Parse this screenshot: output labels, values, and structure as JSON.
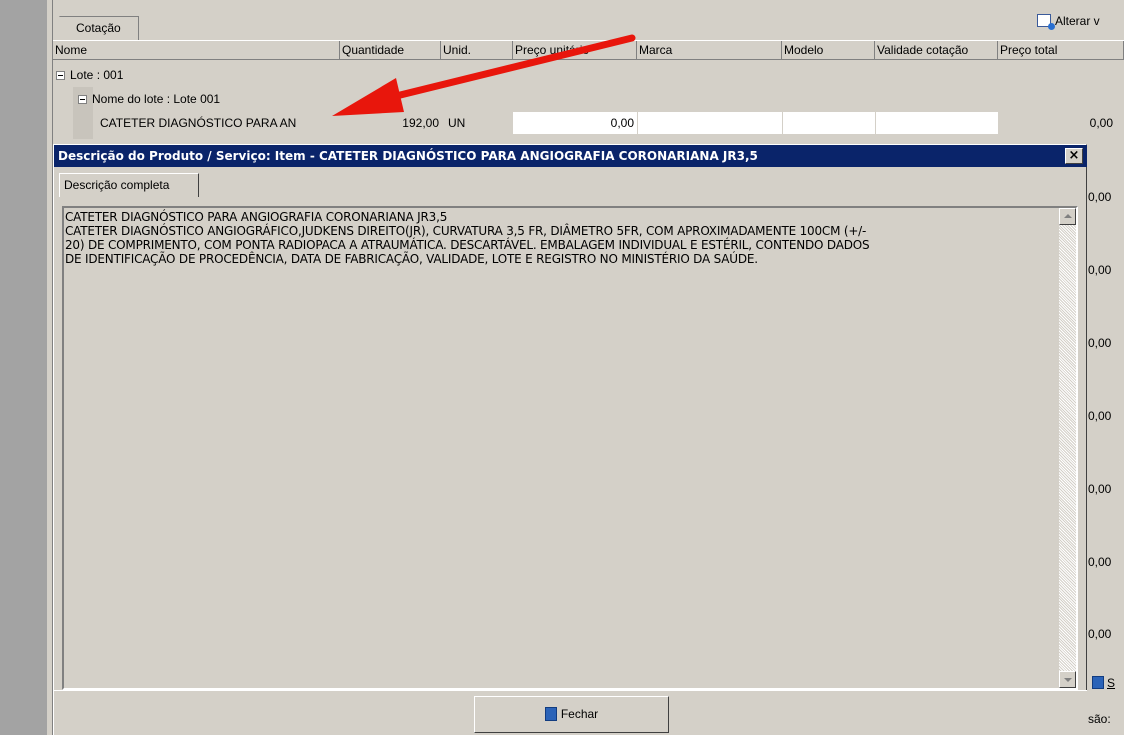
{
  "tabs": {
    "main": "Cotação",
    "alterar": "Alterar v"
  },
  "columns": [
    "Nome",
    "Quantidade",
    "Unid.",
    "Preço unitário",
    "Marca",
    "Modelo",
    "Validade cotação",
    "Preço total"
  ],
  "tree": {
    "lote": "Lote : 001",
    "lote_name": "Nome do lote : Lote 001",
    "item": {
      "name": "CATETER DIAGNÓSTICO PARA AN",
      "quantity": "192,00",
      "unit": "UN",
      "unit_price": "0,00",
      "total": "0,00"
    }
  },
  "right_values": [
    "0,00",
    "0,00",
    "0,00",
    "0,00",
    "0,00",
    "0,00",
    "0,00"
  ],
  "side_labels": {
    "s": "S",
    "sao": "são:"
  },
  "dialog": {
    "title": "Descrição do Produto / Serviço: Item  - CATETER DIAGNÓSTICO PARA ANGIOGRAFIA CORONARIANA JR3,5",
    "close": "×",
    "tab": "Descrição completa",
    "description": "CATETER DIAGNÓSTICO PARA ANGIOGRAFIA CORONARIANA JR3,5\nCATETER DIAGNÓSTICO ANGIOGRÁFICO,JUDKENS DIREITO(JR), CURVATURA 3,5 FR, DIÂMETRO 5FR, COM APROXIMADAMENTE 100CM (+/-\n20) DE COMPRIMENTO, COM PONTA RADIOPACA A ATRAUMÁTICA. DESCARTÁVEL. EMBALAGEM INDIVIDUAL E ESTÉRIL, CONTENDO DADOS\nDE IDENTIFICAÇÃO DE PROCEDÊNCIA, DATA DE FABRICAÇÃO, VALIDADE, LOTE E REGISTRO NO MINISTÉRIO DA SAÚDE.",
    "close_button": "Fechar"
  },
  "annotation": {
    "arrow_color": "#e8160c"
  },
  "colors": {
    "title_bar": "#0a246a",
    "window": "#d4d0c8"
  }
}
